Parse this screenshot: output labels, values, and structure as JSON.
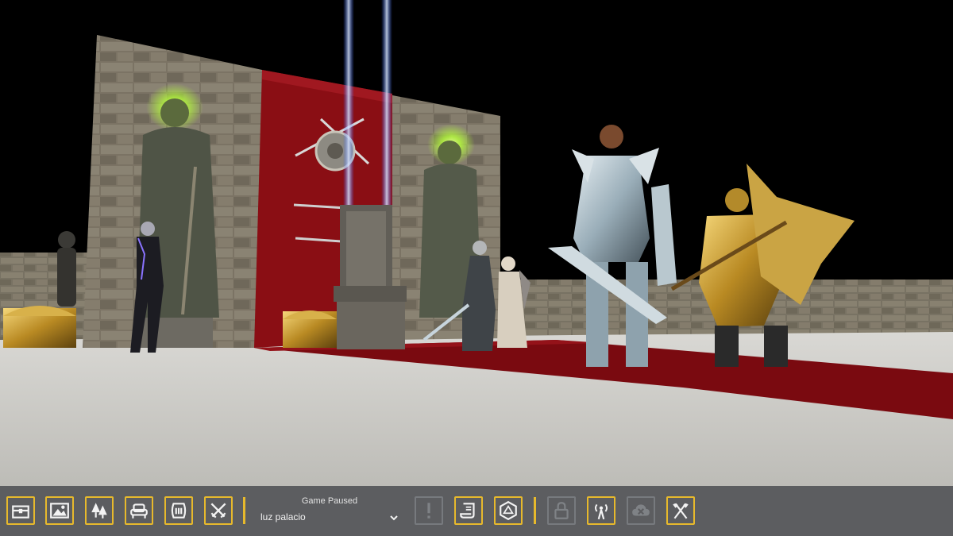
{
  "scene": {
    "description_icons": [
      "stone-wall",
      "red-banner",
      "statue",
      "throne",
      "golden-chest",
      "armored-hero",
      "golden-knight",
      "sorceress",
      "elder-mage"
    ],
    "colors": {
      "floor": "#c6c4bf",
      "carpet": "#7a0a10",
      "stone": "#7d7566",
      "glow": "#b6ff3a",
      "beam": "#4f8dff"
    }
  },
  "toolbar": {
    "accent_color": "#e7b92c",
    "buttons_left": [
      {
        "id": "chest",
        "icon": "chest-icon"
      },
      {
        "id": "image",
        "icon": "landscape-image-icon"
      },
      {
        "id": "trees",
        "icon": "trees-icon"
      },
      {
        "id": "throne",
        "icon": "armchair-icon"
      },
      {
        "id": "barrel",
        "icon": "barrel-icon"
      },
      {
        "id": "swords",
        "icon": "crossed-swords-icon"
      }
    ],
    "status": {
      "title": "Game Paused",
      "scene_name": "luz palacio"
    },
    "buttons_right": [
      {
        "id": "alert",
        "icon": "exclamation-icon",
        "enabled": false
      },
      {
        "id": "scroll",
        "icon": "scroll-icon",
        "enabled": true
      },
      {
        "id": "dice",
        "icon": "dice-icon",
        "enabled": true
      },
      {
        "id": "lock",
        "icon": "lock-icon",
        "enabled": false
      },
      {
        "id": "broadcast",
        "icon": "broadcast-tower-icon",
        "enabled": true
      },
      {
        "id": "cloud",
        "icon": "cloud-off-icon",
        "enabled": false
      },
      {
        "id": "axes",
        "icon": "crossed-axes-icon",
        "enabled": true
      }
    ]
  }
}
